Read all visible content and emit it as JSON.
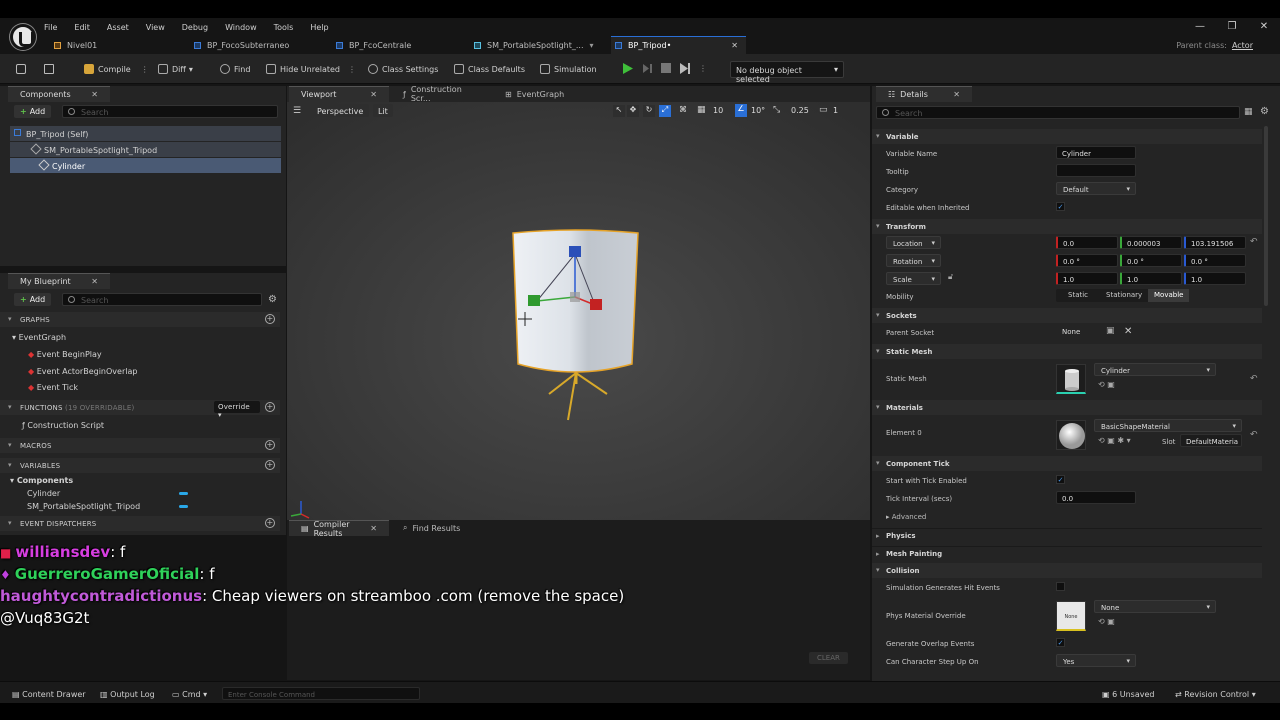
{
  "menu": [
    "File",
    "Edit",
    "Asset",
    "View",
    "Debug",
    "Window",
    "Tools",
    "Help"
  ],
  "tabs": [
    {
      "label": "Nivel01"
    },
    {
      "label": "BP_FocoSubterraneo"
    },
    {
      "label": "BP_FcoCentrale"
    },
    {
      "label": "SM_PortableSpotlight_..."
    },
    {
      "label": "BP_Tripod•"
    }
  ],
  "parent_class": {
    "label": "Parent class:",
    "value": "Actor"
  },
  "toolbar": {
    "compile": "Compile",
    "diff": "Diff",
    "find": "Find",
    "hide_unrelated": "Hide Unrelated",
    "class_settings": "Class Settings",
    "class_defaults": "Class Defaults",
    "simulation": "Simulation",
    "debug_object": "No debug object selected"
  },
  "components_panel": {
    "tab": "Components",
    "add": "Add",
    "search_placeholder": "Search",
    "tree": [
      "BP_Tripod (Self)",
      "SM_PortableSpotlight_Tripod",
      "Cylinder"
    ]
  },
  "blueprint_panel": {
    "tab": "My Blueprint",
    "add": "Add",
    "search_placeholder": "Search",
    "graphs": "GRAPHS",
    "event_graph": "EventGraph",
    "events": [
      "Event BeginPlay",
      "Event ActorBeginOverlap",
      "Event Tick"
    ],
    "functions": "FUNCTIONS",
    "functions_count": "(19 OVERRIDABLE)",
    "override": "Override",
    "construction_script": "Construction Script",
    "macros": "MACROS",
    "variables": "VARIABLES",
    "components": "Components",
    "vars": [
      "Cylinder",
      "SM_PortableSpotlight_Tripod"
    ],
    "event_dispatchers": "EVENT DISPATCHERS"
  },
  "viewport": {
    "tabs": [
      "Viewport",
      "Construction Scr...",
      "EventGraph"
    ],
    "perspective": "Perspective",
    "lit": "Lit",
    "grid": "10",
    "angle": "10°",
    "scale": "0.25",
    "camera": "1"
  },
  "bottom_tabs": {
    "compiler": "Compiler Results",
    "find": "Find Results",
    "clear": "CLEAR"
  },
  "details": {
    "tab": "Details",
    "search_placeholder": "Search",
    "variable": "Variable",
    "variable_name_label": "Variable Name",
    "variable_name": "Cylinder",
    "tooltip_label": "Tooltip",
    "category_label": "Category",
    "category": "Default",
    "editable_label": "Editable when Inherited",
    "transform": "Transform",
    "location": "Location",
    "location_vals": [
      "0.0",
      "0.000003",
      "103.191506"
    ],
    "rotation": "Rotation",
    "rotation_vals": [
      "0.0 °",
      "0.0 °",
      "0.0 °"
    ],
    "scale": "Scale",
    "scale_vals": [
      "1.0",
      "1.0",
      "1.0"
    ],
    "mobility": "Mobility",
    "mobility_opts": [
      "Static",
      "Stationary",
      "Movable"
    ],
    "sockets": "Sockets",
    "parent_socket_label": "Parent Socket",
    "parent_socket": "None",
    "static_mesh_section": "Static Mesh",
    "static_mesh_label": "Static Mesh",
    "static_mesh": "Cylinder",
    "materials": "Materials",
    "element0_label": "Element 0",
    "element0": "BasicShapeMaterial",
    "slot_label": "Slot",
    "slot": "DefaultMateria",
    "component_tick": "Component Tick",
    "start_tick_label": "Start with Tick Enabled",
    "tick_interval_label": "Tick Interval (secs)",
    "tick_interval": "0.0",
    "advanced": "Advanced",
    "physics": "Physics",
    "mesh_painting": "Mesh Painting",
    "collision": "Collision",
    "sim_hit_label": "Simulation Generates Hit Events",
    "phys_mat_label": "Phys Material Override",
    "phys_mat": "None",
    "phys_mat_thumb": "None",
    "overlap_label": "Generate Overlap Events",
    "step_label": "Can Character Step Up On",
    "step": "Yes"
  },
  "chat": [
    {
      "user": "williansdev",
      "msg": ": f",
      "color": "#d63ee0"
    },
    {
      "user": "GuerreroGamerOficial",
      "msg": ": f",
      "color": "#2fd15a"
    },
    {
      "user": "haughtycontradictionus",
      "msg": ": Cheap viewers on streamboo .com (remove the space)",
      "color": "#c05ad8"
    },
    {
      "user": "",
      "msg": "@Vuq83G2t",
      "color": "#ffffff"
    }
  ],
  "statusbar": {
    "content_drawer": "Content Drawer",
    "output_log": "Output Log",
    "cmd": "Cmd",
    "console_placeholder": "Enter Console Command",
    "unsaved": "6 Unsaved",
    "revision": "Revision Control"
  },
  "colors": {
    "accent": "#2a6fd6",
    "play": "#3fbf3a",
    "x_axis": "#d32a2a",
    "y_axis": "#3aa83a",
    "z_axis": "#2a5ad3",
    "selection": "#e0a52c"
  }
}
